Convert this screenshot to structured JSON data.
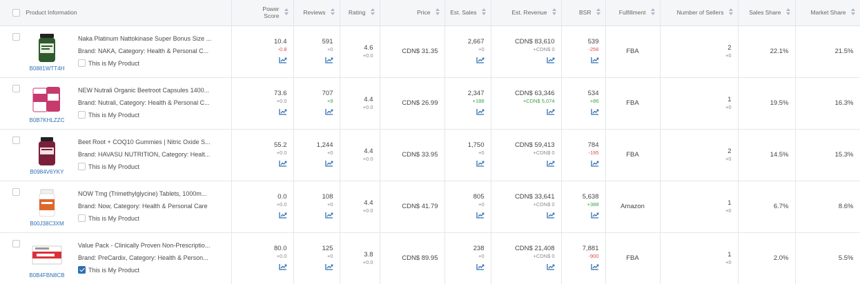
{
  "header": {
    "product_info": "Product Information",
    "power_score": [
      "Power",
      "Score"
    ],
    "reviews": "Reviews",
    "rating": "Rating",
    "price": "Price",
    "est_sales": "Est. Sales",
    "est_revenue": "Est. Revenue",
    "bsr": "BSR",
    "fulfillment": "Fulfillment",
    "sellers": "Number of Sellers",
    "sales_share": "Sales Share",
    "market_share": "Market Share"
  },
  "my_product_label": "This is My Product",
  "rows": [
    {
      "asin": "B0881WTT4H",
      "title": "Naka Platinum Nattokinase Super Bonus Size ...",
      "brand_line": "Brand: NAKA,  Category: Health & Personal C...",
      "is_mine": false,
      "power": "10.4",
      "power_d": "-0.8",
      "reviews": "591",
      "reviews_d": "+0",
      "rating": "4.6",
      "rating_d": "+0.0",
      "price": "CDN$ 31.35",
      "sales": "2,667",
      "sales_d": "+0",
      "revenue": "CDN$ 83,610",
      "revenue_d": "+CDN$ 0",
      "bsr": "539",
      "bsr_d": "-256",
      "fulfillment": "FBA",
      "sellers": "2",
      "sellers_d": "+0",
      "sales_share": "22.1%",
      "market_share": "21.5%",
      "thumb_color": "#2f5a2e"
    },
    {
      "asin": "B0B7KHLZZC",
      "title": "NEW Nutrali Organic Beetroot Capsules 1400...",
      "brand_line": "Brand: Nutrali,  Category: Health & Personal C...",
      "is_mine": false,
      "power": "73.6",
      "power_d": "+0.0",
      "reviews": "707",
      "reviews_d": "+9",
      "rating": "4.4",
      "rating_d": "+0.0",
      "price": "CDN$ 26.99",
      "sales": "2,347",
      "sales_d": "+188",
      "revenue": "CDN$ 63,346",
      "revenue_d": "+CDN$ 5,074",
      "bsr": "534",
      "bsr_d": "+86",
      "fulfillment": "FBA",
      "sellers": "1",
      "sellers_d": "+0",
      "sales_share": "19.5%",
      "market_share": "16.3%",
      "thumb_color": "#c63a6e"
    },
    {
      "asin": "B0984V6YKY",
      "title": "Beet Root + COQ10 Gummies | Nitric Oxide S...",
      "brand_line": "Brand: HAVASU NUTRITION,  Category: Healt...",
      "is_mine": false,
      "power": "55.2",
      "power_d": "+0.0",
      "reviews": "1,244",
      "reviews_d": "+0",
      "rating": "4.4",
      "rating_d": "+0.0",
      "price": "CDN$ 33.95",
      "sales": "1,750",
      "sales_d": "+0",
      "revenue": "CDN$ 59,413",
      "revenue_d": "+CDN$ 0",
      "bsr": "784",
      "bsr_d": "-195",
      "fulfillment": "FBA",
      "sellers": "2",
      "sellers_d": "+0",
      "sales_share": "14.5%",
      "market_share": "15.3%",
      "thumb_color": "#7a1f3a"
    },
    {
      "asin": "B00J38C3XM",
      "title": "NOW Tmg (Trimethylglycine) Tablets, 1000m...",
      "brand_line": "Brand: Now,  Category: Health & Personal Care",
      "is_mine": false,
      "power": "0.0",
      "power_d": "+0.0",
      "reviews": "108",
      "reviews_d": "+0",
      "rating": "4.4",
      "rating_d": "+0.0",
      "price": "CDN$ 41.79",
      "sales": "805",
      "sales_d": "+0",
      "revenue": "CDN$ 33,641",
      "revenue_d": "+CDN$ 0",
      "bsr": "5,638",
      "bsr_d": "+388",
      "fulfillment": "Amazon",
      "sellers": "1",
      "sellers_d": "+0",
      "sales_share": "6.7%",
      "market_share": "8.6%",
      "thumb_color": "#e0672b"
    },
    {
      "asin": "B0B4FBN8CB",
      "title": "Value Pack - Clinically Proven Non-Prescriptio...",
      "brand_line": "Brand: PreCardix,  Category: Health & Person...",
      "is_mine": true,
      "power": "80.0",
      "power_d": "+0.0",
      "reviews": "125",
      "reviews_d": "+0",
      "rating": "3.8",
      "rating_d": "+0.0",
      "price": "CDN$ 89.95",
      "sales": "238",
      "sales_d": "+0",
      "revenue": "CDN$ 21,408",
      "revenue_d": "+CDN$ 0",
      "bsr": "7,881",
      "bsr_d": "-900",
      "fulfillment": "FBA",
      "sellers": "1",
      "sellers_d": "+0",
      "sales_share": "2.0%",
      "market_share": "5.5%",
      "thumb_color": "#d9323a"
    }
  ],
  "colors": {
    "asin_link": "#2f6fb3",
    "positive": "#3aa14a",
    "negative": "#e14b4b",
    "trend_icon": "#2f6fb3"
  }
}
